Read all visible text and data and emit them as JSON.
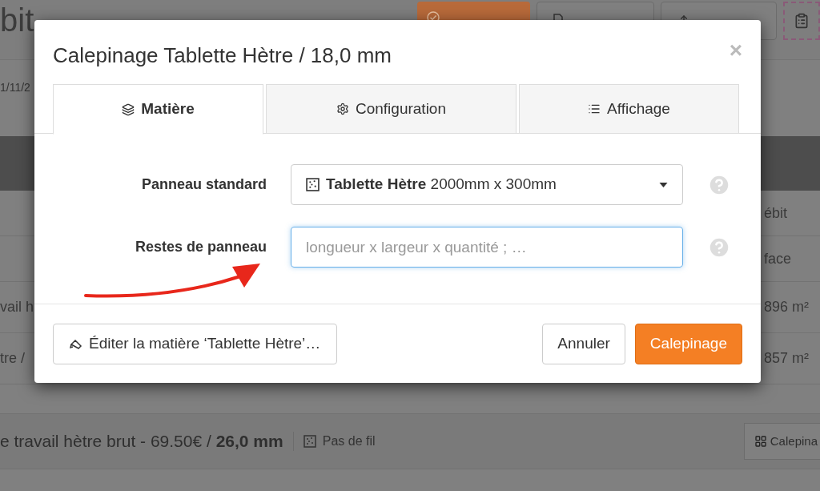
{
  "background": {
    "title": "bit",
    "date": "1/11/2",
    "column_labels": [
      "ébit",
      "face"
    ],
    "rows": [
      {
        "name": "vail h",
        "area": "896 m²"
      },
      {
        "name": "tre /",
        "area": "857 m²"
      }
    ],
    "material": {
      "text": "e travail hètre brut - 69.50€ / **26,0 mm**",
      "grain": "Pas de fil",
      "button": "Calepina"
    }
  },
  "dialog": {
    "title": "Calepinage Tablette Hètre / 18,0 mm",
    "close": "×",
    "tabs": [
      {
        "label": "Matière",
        "selected": true
      },
      {
        "label": "Configuration",
        "selected": false
      },
      {
        "label": "Affichage",
        "selected": false
      }
    ],
    "fields": [
      {
        "kind": "select",
        "label": "Panneau standard",
        "value": "**Tablette Hètre** 2000mm x 300mm"
      },
      {
        "kind": "input",
        "label": "Restes de panneau",
        "placeholder": "longueur x largeur x quantité ; …"
      }
    ],
    "footer": {
      "edit_button": "Éditer la matière ‘Tablette Hètre’…",
      "cancel": "Annuler",
      "submit": "Calepinage"
    }
  }
}
